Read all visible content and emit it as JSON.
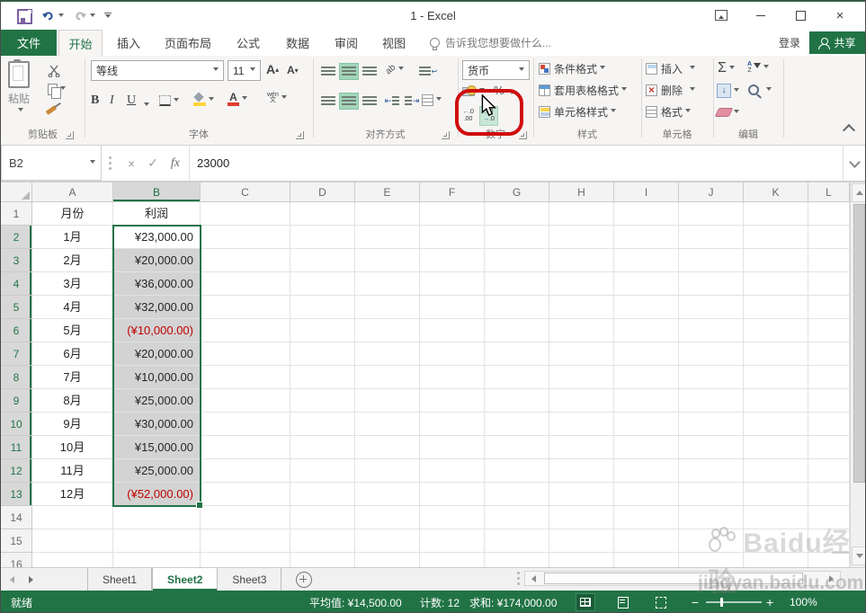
{
  "window": {
    "title": "1 - Excel",
    "qat": [
      "save-icon",
      "undo-icon",
      "redo-icon",
      "customize-icon"
    ]
  },
  "tabs": {
    "file": "文件",
    "items": [
      "开始",
      "插入",
      "页面布局",
      "公式",
      "数据",
      "审阅",
      "视图"
    ],
    "active": "开始",
    "tell_me": "告诉我您想要做什么...",
    "sign_in": "登录",
    "share": "共享"
  },
  "ribbon": {
    "clipboard": {
      "label": "剪贴板",
      "paste": "粘贴"
    },
    "font": {
      "label": "字体",
      "name": "等线",
      "size": "11",
      "bold": "B",
      "italic": "I",
      "underline": "U"
    },
    "alignment": {
      "label": "对齐方式"
    },
    "number": {
      "label": "数字",
      "format": "货币",
      "percent": "%",
      "comma": ",",
      "inc_decimal": "←.0|.00",
      "dec_decimal": ".00|→.0"
    },
    "styles": {
      "label": "样式",
      "conditional": "条件格式",
      "format_table": "套用表格格式",
      "cell_styles": "单元格样式"
    },
    "cells": {
      "label": "单元格",
      "insert": "插入",
      "delete": "删除",
      "format": "格式"
    },
    "editing": {
      "label": "编辑",
      "autosum": "Σ"
    }
  },
  "formula_bar": {
    "name_box": "B2",
    "fx_label": "fx",
    "value": "23000"
  },
  "grid": {
    "col_letters": [
      "A",
      "B",
      "C",
      "D",
      "E",
      "F",
      "G",
      "H",
      "I",
      "J",
      "K",
      "L"
    ],
    "num_rows": 16,
    "active_col": "B",
    "active_cell": "B2",
    "sel_row_start": 2,
    "sel_row_end": 13,
    "header_month": "月份",
    "header_profit": "利润",
    "rows": [
      {
        "month": "1月",
        "value": "¥23,000.00",
        "negative": false
      },
      {
        "month": "2月",
        "value": "¥20,000.00",
        "negative": false
      },
      {
        "month": "3月",
        "value": "¥36,000.00",
        "negative": false
      },
      {
        "month": "4月",
        "value": "¥32,000.00",
        "negative": false
      },
      {
        "month": "5月",
        "value": "(¥10,000.00)",
        "negative": true
      },
      {
        "month": "6月",
        "value": "¥20,000.00",
        "negative": false
      },
      {
        "month": "7月",
        "value": "¥10,000.00",
        "negative": false
      },
      {
        "month": "8月",
        "value": "¥25,000.00",
        "negative": false
      },
      {
        "month": "9月",
        "value": "¥30,000.00",
        "negative": false
      },
      {
        "month": "10月",
        "value": "¥15,000.00",
        "negative": false
      },
      {
        "month": "11月",
        "value": "¥25,000.00",
        "negative": false
      },
      {
        "month": "12月",
        "value": "(¥52,000.00)",
        "negative": true
      }
    ]
  },
  "sheet_tabs": {
    "sheet1": "Sheet1",
    "sheet2": "Sheet2",
    "sheet3": "Sheet3",
    "active": "Sheet2"
  },
  "status": {
    "ready": "就绪",
    "average": "平均值: ¥14,500.00",
    "count": "计数: 12",
    "sum": "求和: ¥174,000.00",
    "zoom_level": "100%"
  },
  "watermark": {
    "brand": "Baidu经验",
    "site": "jingyan.baidu.com"
  },
  "colors": {
    "accent": "#217346",
    "negative": "#c00000",
    "annotation": "#cf0d0d",
    "selection_fill": "#d3d3d3"
  }
}
